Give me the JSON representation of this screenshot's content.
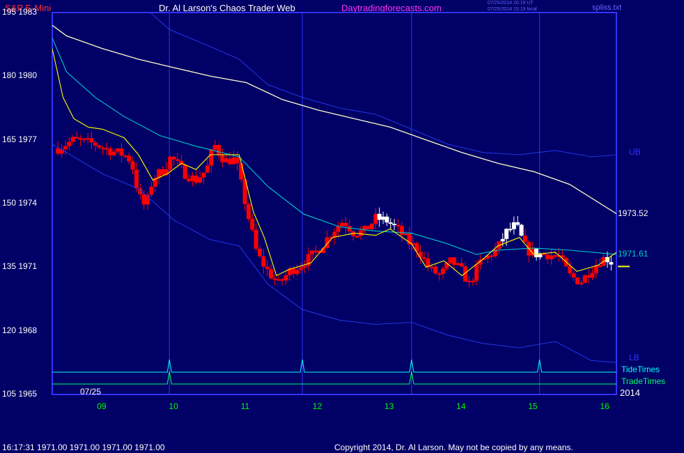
{
  "header": {
    "symbol": "S&P E-Mini",
    "title": "Dr. Al Larson's Chaos Trader Web",
    "site": "Daytradingforecasts.com",
    "ut_stamp": "07/25/2014 20:19 UT",
    "local_stamp": "07/25/2014 15:19 local",
    "file": "spliss.txt"
  },
  "footer": {
    "status": "16:17:31   1971.00  1971.00  1971.00  1971.00",
    "copyright": "Copyright 2014, Dr. Al Larson. May not be copied by any means."
  },
  "colors": {
    "background": "#000066",
    "frame": "#3333ff",
    "up_bar": "#ffffff",
    "down_bar": "#ff0000",
    "band": "#2233dd",
    "slow_average": "#ffffcc",
    "mid_average": "#00cccc",
    "fast_average": "#ffff00",
    "tide_times": "#00ffff",
    "trade_times": "#00ff66",
    "hour_labels": "#00ff00"
  },
  "chart_data": {
    "type": "bar",
    "title": "S&P E-Mini",
    "date_label": "07/25",
    "year_label": "2014",
    "xlim": [
      8.3,
      16.15
    ],
    "ylim": [
      1965,
      1983
    ],
    "x_ticks": [
      {
        "x": 9,
        "label": "09"
      },
      {
        "x": 10,
        "label": "10"
      },
      {
        "x": 11,
        "label": "11"
      },
      {
        "x": 12,
        "label": "12"
      },
      {
        "x": 13,
        "label": "13"
      },
      {
        "x": 14,
        "label": "14"
      },
      {
        "x": 15,
        "label": "15"
      },
      {
        "x": 16,
        "label": "16"
      }
    ],
    "y_ticks": [
      {
        "value": 1983,
        "label": "195  1983"
      },
      {
        "value": 1980,
        "label": "180  1980"
      },
      {
        "value": 1977,
        "label": "165  1977"
      },
      {
        "value": 1974,
        "label": "150  1974"
      },
      {
        "value": 1971,
        "label": "135  1971"
      },
      {
        "value": 1968,
        "label": "120  1968"
      },
      {
        "value": 1965,
        "label": "105  1965"
      }
    ],
    "vertical_markers": [
      9.93,
      11.78,
      13.3,
      15.08
    ],
    "series": [
      {
        "name": "UB",
        "values": [
          [
            8.3,
            1984.0
          ],
          [
            9.0,
            1983.8
          ],
          [
            9.5,
            1983.5
          ],
          [
            9.93,
            1982.2
          ],
          [
            10.5,
            1981.4
          ],
          [
            10.9,
            1980.8
          ],
          [
            11.3,
            1979.6
          ],
          [
            11.78,
            1979.0
          ],
          [
            12.3,
            1978.5
          ],
          [
            12.8,
            1978.2
          ],
          [
            13.3,
            1977.5
          ],
          [
            13.8,
            1976.8
          ],
          [
            14.3,
            1976.4
          ],
          [
            14.8,
            1976.3
          ],
          [
            15.3,
            1976.5
          ],
          [
            15.8,
            1976.2
          ],
          [
            16.15,
            1976.3
          ]
        ]
      },
      {
        "name": "",
        "values": [
          [
            8.3,
            1982.4
          ],
          [
            8.5,
            1981.9
          ],
          [
            9.0,
            1981.3
          ],
          [
            9.5,
            1980.8
          ],
          [
            10.0,
            1980.4
          ],
          [
            10.5,
            1980.0
          ],
          [
            11.0,
            1979.7
          ],
          [
            11.5,
            1978.9
          ],
          [
            12.0,
            1978.4
          ],
          [
            12.5,
            1978.0
          ],
          [
            13.0,
            1977.6
          ],
          [
            13.5,
            1977.0
          ],
          [
            14.0,
            1976.4
          ],
          [
            14.5,
            1975.9
          ],
          [
            15.0,
            1975.5
          ],
          [
            15.5,
            1974.9
          ],
          [
            16.15,
            1973.52
          ]
        ]
      },
      {
        "name": "",
        "values": [
          [
            8.3,
            1981.8
          ],
          [
            8.5,
            1980.2
          ],
          [
            8.9,
            1979.0
          ],
          [
            9.3,
            1978.1
          ],
          [
            9.8,
            1977.2
          ],
          [
            10.3,
            1976.7
          ],
          [
            10.9,
            1976.2
          ],
          [
            11.3,
            1974.8
          ],
          [
            11.8,
            1973.5
          ],
          [
            12.3,
            1972.9
          ],
          [
            12.8,
            1972.7
          ],
          [
            13.3,
            1972.6
          ],
          [
            13.8,
            1972.1
          ],
          [
            14.2,
            1971.6
          ],
          [
            14.5,
            1971.8
          ],
          [
            15.0,
            1971.9
          ],
          [
            15.5,
            1971.8
          ],
          [
            16.15,
            1971.6
          ]
        ]
      },
      {
        "name": "",
        "values": [
          [
            8.3,
            1981.3
          ],
          [
            8.45,
            1979.0
          ],
          [
            8.6,
            1978.0
          ],
          [
            8.8,
            1977.6
          ],
          [
            9.0,
            1977.5
          ],
          [
            9.3,
            1977.1
          ],
          [
            9.5,
            1976.3
          ],
          [
            9.7,
            1975.1
          ],
          [
            9.9,
            1975.4
          ],
          [
            10.1,
            1975.9
          ],
          [
            10.3,
            1975.6
          ],
          [
            10.5,
            1976.3
          ],
          [
            10.9,
            1976.3
          ],
          [
            11.1,
            1973.6
          ],
          [
            11.25,
            1972.4
          ],
          [
            11.42,
            1970.6
          ],
          [
            11.6,
            1970.9
          ],
          [
            11.9,
            1971.2
          ],
          [
            12.2,
            1972.4
          ],
          [
            12.5,
            1972.6
          ],
          [
            12.8,
            1972.5
          ],
          [
            13.0,
            1972.8
          ],
          [
            13.3,
            1972.1
          ],
          [
            13.5,
            1971.0
          ],
          [
            13.75,
            1971.3
          ],
          [
            14.0,
            1970.6
          ],
          [
            14.3,
            1971.4
          ],
          [
            14.5,
            1972.0
          ],
          [
            14.8,
            1972.4
          ],
          [
            15.0,
            1971.6
          ],
          [
            15.3,
            1971.7
          ],
          [
            15.6,
            1970.8
          ],
          [
            15.9,
            1971.1
          ],
          [
            16.15,
            1971.7
          ]
        ]
      },
      {
        "name": "LB",
        "values": [
          [
            8.3,
            1976.8
          ],
          [
            8.6,
            1976.2
          ],
          [
            9.0,
            1975.4
          ],
          [
            9.5,
            1974.7
          ],
          [
            10.0,
            1973.2
          ],
          [
            10.5,
            1972.3
          ],
          [
            10.9,
            1972.0
          ],
          [
            11.3,
            1970.2
          ],
          [
            11.78,
            1969.0
          ],
          [
            12.3,
            1968.5
          ],
          [
            12.8,
            1968.3
          ],
          [
            13.3,
            1968.4
          ],
          [
            13.8,
            1967.8
          ],
          [
            14.3,
            1967.4
          ],
          [
            14.8,
            1967.2
          ],
          [
            15.3,
            1967.5
          ],
          [
            15.8,
            1966.6
          ],
          [
            16.15,
            1966.5
          ]
        ]
      }
    ],
    "bar_path": [
      [
        8.38,
        1976.6
      ],
      [
        8.6,
        1977.0
      ],
      [
        8.9,
        1976.8
      ],
      [
        9.1,
        1976.5
      ],
      [
        9.3,
        1976.3
      ],
      [
        9.4,
        1976.0
      ],
      [
        9.5,
        1974.4
      ],
      [
        9.6,
        1973.8
      ],
      [
        9.7,
        1975.2
      ],
      [
        9.85,
        1975.6
      ],
      [
        9.95,
        1976.2
      ],
      [
        10.05,
        1975.8
      ],
      [
        10.15,
        1975.4
      ],
      [
        10.3,
        1975.1
      ],
      [
        10.45,
        1975.6
      ],
      [
        10.55,
        1976.8
      ],
      [
        10.7,
        1976.0
      ],
      [
        10.85,
        1976.1
      ],
      [
        11.0,
        1973.8
      ],
      [
        11.15,
        1971.6
      ],
      [
        11.3,
        1970.8
      ],
      [
        11.45,
        1970.2
      ],
      [
        11.6,
        1970.8
      ],
      [
        11.75,
        1971.1
      ],
      [
        11.9,
        1971.5
      ],
      [
        12.05,
        1972.0
      ],
      [
        12.2,
        1972.7
      ],
      [
        12.35,
        1973.2
      ],
      [
        12.5,
        1972.6
      ],
      [
        12.65,
        1972.7
      ],
      [
        12.8,
        1973.3
      ],
      [
        12.95,
        1973.2
      ],
      [
        13.1,
        1972.8
      ],
      [
        13.25,
        1972.2
      ],
      [
        13.4,
        1971.8
      ],
      [
        13.55,
        1970.9
      ],
      [
        13.7,
        1970.6
      ],
      [
        13.85,
        1971.3
      ],
      [
        14.0,
        1970.8
      ],
      [
        14.1,
        1970.2
      ],
      [
        14.25,
        1971.2
      ],
      [
        14.4,
        1971.6
      ],
      [
        14.5,
        1971.9
      ],
      [
        14.6,
        1972.6
      ],
      [
        14.75,
        1973.0
      ],
      [
        14.9,
        1971.8
      ],
      [
        15.05,
        1971.6
      ],
      [
        15.2,
        1971.6
      ],
      [
        15.35,
        1971.5
      ],
      [
        15.5,
        1970.6
      ],
      [
        15.65,
        1970.3
      ],
      [
        15.8,
        1970.9
      ],
      [
        15.95,
        1971.4
      ],
      [
        16.05,
        1971.4
      ],
      [
        16.12,
        1971.0
      ]
    ],
    "bar_up_windows": [
      [
        12.85,
        13.1
      ],
      [
        14.55,
        14.85
      ],
      [
        15.0,
        15.1
      ],
      [
        16.0,
        16.1
      ]
    ],
    "last_price": 1971.0,
    "price_labels": [
      {
        "label": "1973.52",
        "value": 1973.52
      },
      {
        "label": "1971.61",
        "value": 1971.61
      },
      {
        "label": "UB",
        "value": 1976.4
      },
      {
        "label": "LB",
        "value": 1966.7
      }
    ],
    "timing_lines": [
      {
        "name": "TideTimes",
        "peaks": [
          9.93,
          11.78,
          13.3,
          15.08
        ]
      },
      {
        "name": "TradeTimes",
        "peaks": [
          9.93,
          13.3
        ]
      }
    ]
  }
}
